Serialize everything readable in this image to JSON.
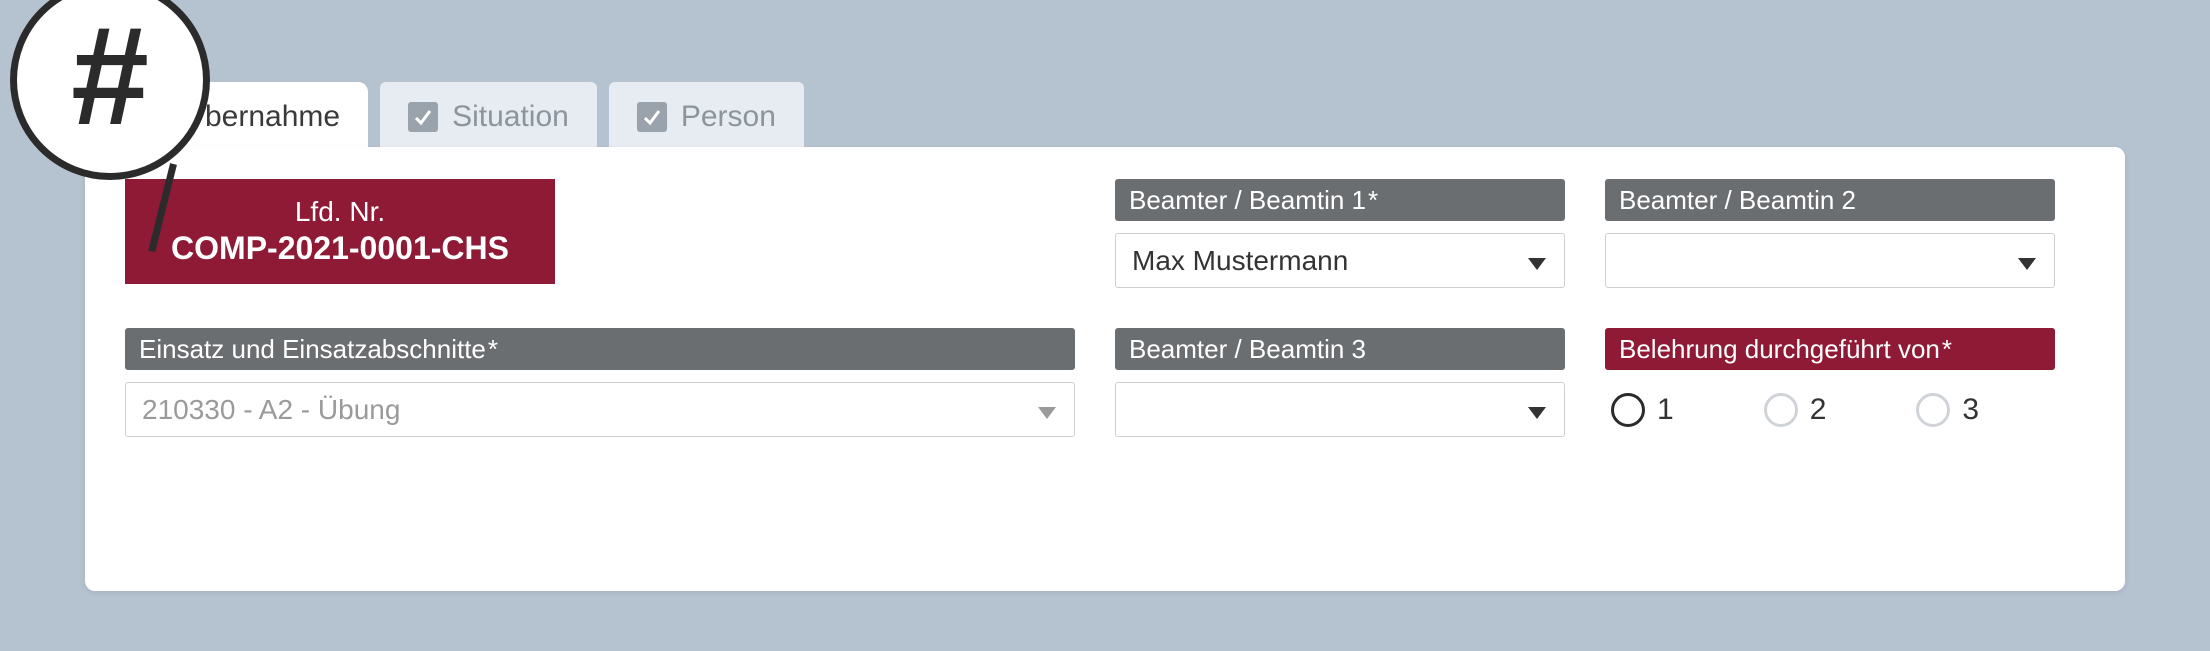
{
  "magnifier_glyph": "#",
  "tabs": {
    "active_label": "bernahme",
    "situation_label": "Situation",
    "person_label": "Person"
  },
  "lfd": {
    "label": "Lfd. Nr.",
    "value": "COMP-2021-0001-CHS"
  },
  "einsatz": {
    "label": "Einsatz und Einsatzabschnitte",
    "value": "210330 - A2 - Übung"
  },
  "beamter1": {
    "label": "Beamter / Beamtin 1",
    "value": "Max Mustermann"
  },
  "beamter2": {
    "label": "Beamter / Beamtin 2",
    "value": ""
  },
  "beamter3": {
    "label": "Beamter / Beamtin 3",
    "value": ""
  },
  "belehrung": {
    "label": "Belehrung durchgeführt von",
    "options": [
      "1",
      "2",
      "3"
    ]
  }
}
